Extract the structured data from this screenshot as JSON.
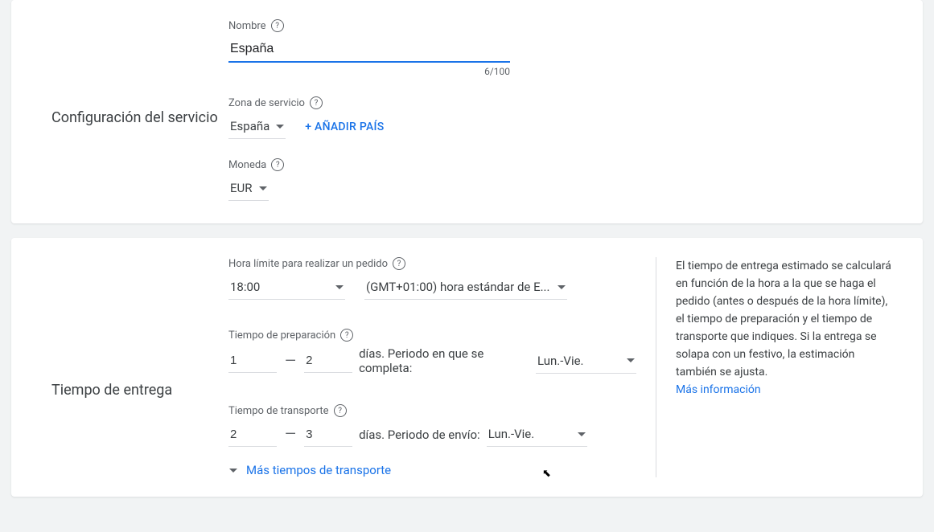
{
  "serviceConfig": {
    "sectionTitle": "Configuración del servicio",
    "nameLabel": "Nombre",
    "nameValue": "España",
    "nameCharCount": "6/100",
    "serviceAreaLabel": "Zona de servicio",
    "country": "España",
    "addCountry": "+ AÑADIR PAÍS",
    "currencyLabel": "Moneda",
    "currency": "EUR"
  },
  "deliveryTime": {
    "sectionTitle": "Tiempo de entrega",
    "cutoffLabel": "Hora límite para realizar un pedido",
    "cutoffTime": "18:00",
    "timezone": "(GMT+01:00) hora estándar de E...",
    "prepLabel": "Tiempo de preparación",
    "prepMin": "1",
    "prepMax": "2",
    "prepText": "días. Periodo en que se completa:",
    "prepSchedule": "Lun.-Vie.",
    "transitLabel": "Tiempo de transporte",
    "transitMin": "2",
    "transitMax": "3",
    "transitText": "días. Periodo de envío:",
    "transitSchedule": "Lun.-Vie.",
    "moreTransit": "Más tiempos de transporte",
    "infoText": "El tiempo de entrega estimado se calculará en función de la hora a la que se haga el pedido (antes o después de la hora límite), el tiempo de preparación y el tiempo de transporte que indiques. Si la entrega se solapa con un festivo, la estimación también se ajusta.",
    "moreInfo": "Más información"
  }
}
